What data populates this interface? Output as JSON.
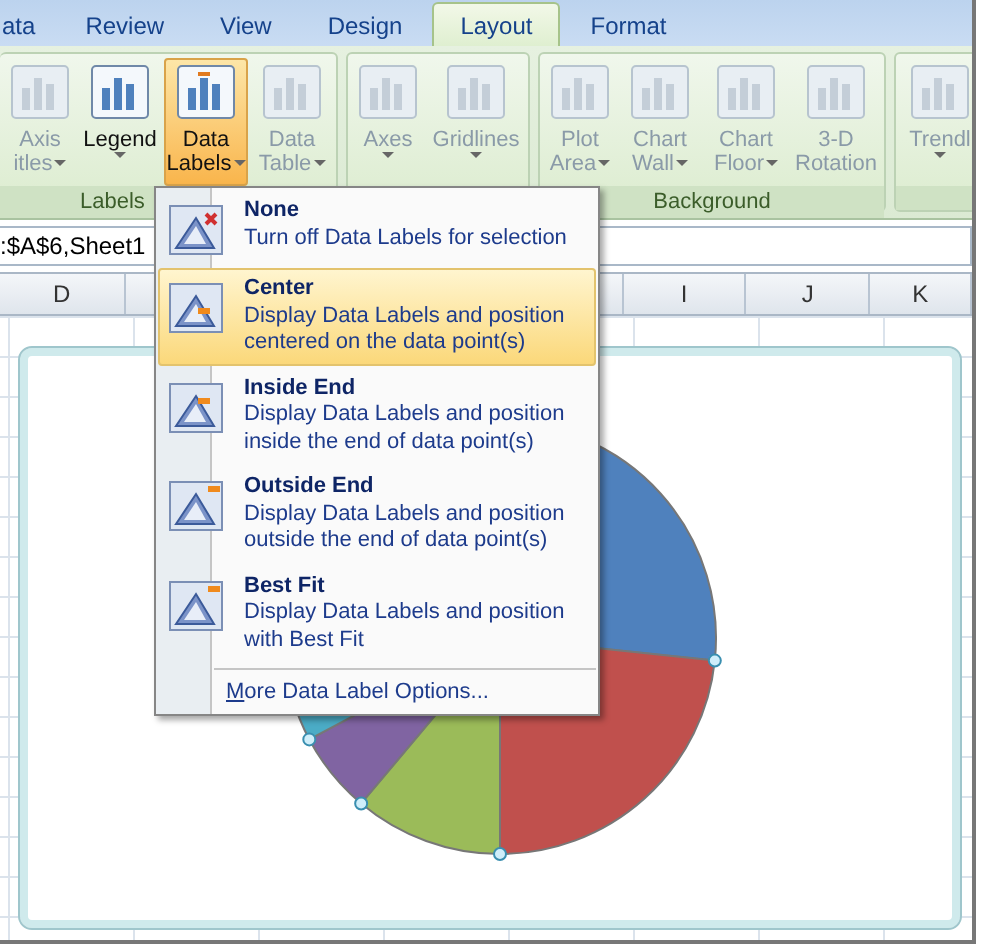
{
  "ribbon_tabs": [
    {
      "label": "ata",
      "selected": false
    },
    {
      "label": "Review",
      "selected": false
    },
    {
      "label": "View",
      "selected": false
    },
    {
      "label": "Design",
      "selected": false
    },
    {
      "label": "Layout",
      "selected": true
    },
    {
      "label": "Format",
      "selected": false
    }
  ],
  "ribbon_groups": [
    {
      "label": "Labels",
      "buttons": [
        {
          "lines": [
            "Axis",
            "itles"
          ],
          "dropdown": true,
          "disabled": true,
          "pressed": false
        },
        {
          "lines": [
            "Legend"
          ],
          "dropdown": true,
          "disabled": false,
          "pressed": false
        },
        {
          "lines": [
            "Data",
            "Labels"
          ],
          "dropdown": true,
          "disabled": false,
          "pressed": true
        },
        {
          "lines": [
            "Data",
            "Table"
          ],
          "dropdown": true,
          "disabled": true,
          "pressed": false
        }
      ]
    },
    {
      "buttons": [
        {
          "lines": [
            "Axes"
          ],
          "dropdown": true,
          "disabled": true,
          "pressed": false
        },
        {
          "lines": [
            "Gridlines"
          ],
          "dropdown": true,
          "disabled": true,
          "pressed": false
        }
      ]
    },
    {
      "label": "Background",
      "buttons": [
        {
          "lines": [
            "Plot",
            "Area"
          ],
          "dropdown": true,
          "disabled": true,
          "pressed": false
        },
        {
          "lines": [
            "Chart",
            "Wall"
          ],
          "dropdown": true,
          "disabled": true,
          "pressed": false
        },
        {
          "lines": [
            "Chart",
            "Floor"
          ],
          "dropdown": true,
          "disabled": true,
          "pressed": false
        },
        {
          "lines": [
            "3-D",
            "Rotation"
          ],
          "dropdown": false,
          "disabled": true,
          "pressed": false
        }
      ]
    },
    {
      "buttons": [
        {
          "lines": [
            "Trendl"
          ],
          "dropdown": true,
          "disabled": true,
          "pressed": false
        }
      ]
    }
  ],
  "formula_bar": {
    "value": ":$A$6,Sheet1"
  },
  "column_headers": [
    "D",
    "I",
    "J",
    "K"
  ],
  "menu": {
    "items": [
      {
        "title": "None",
        "description": "Turn off Data Labels for selection",
        "selected": false
      },
      {
        "title": "Center",
        "description": "Display Data Labels and position centered on the data point(s)",
        "selected": true
      },
      {
        "title": "Inside End",
        "description": "Display Data Labels and position inside the end of data point(s)",
        "selected": false
      },
      {
        "title": "Outside End",
        "description": "Display Data Labels and position outside the end of data point(s)",
        "selected": false
      },
      {
        "title": "Best Fit",
        "description": "Display Data Labels and position with Best Fit",
        "selected": false
      }
    ],
    "footer": "More Data Label Options..."
  }
}
